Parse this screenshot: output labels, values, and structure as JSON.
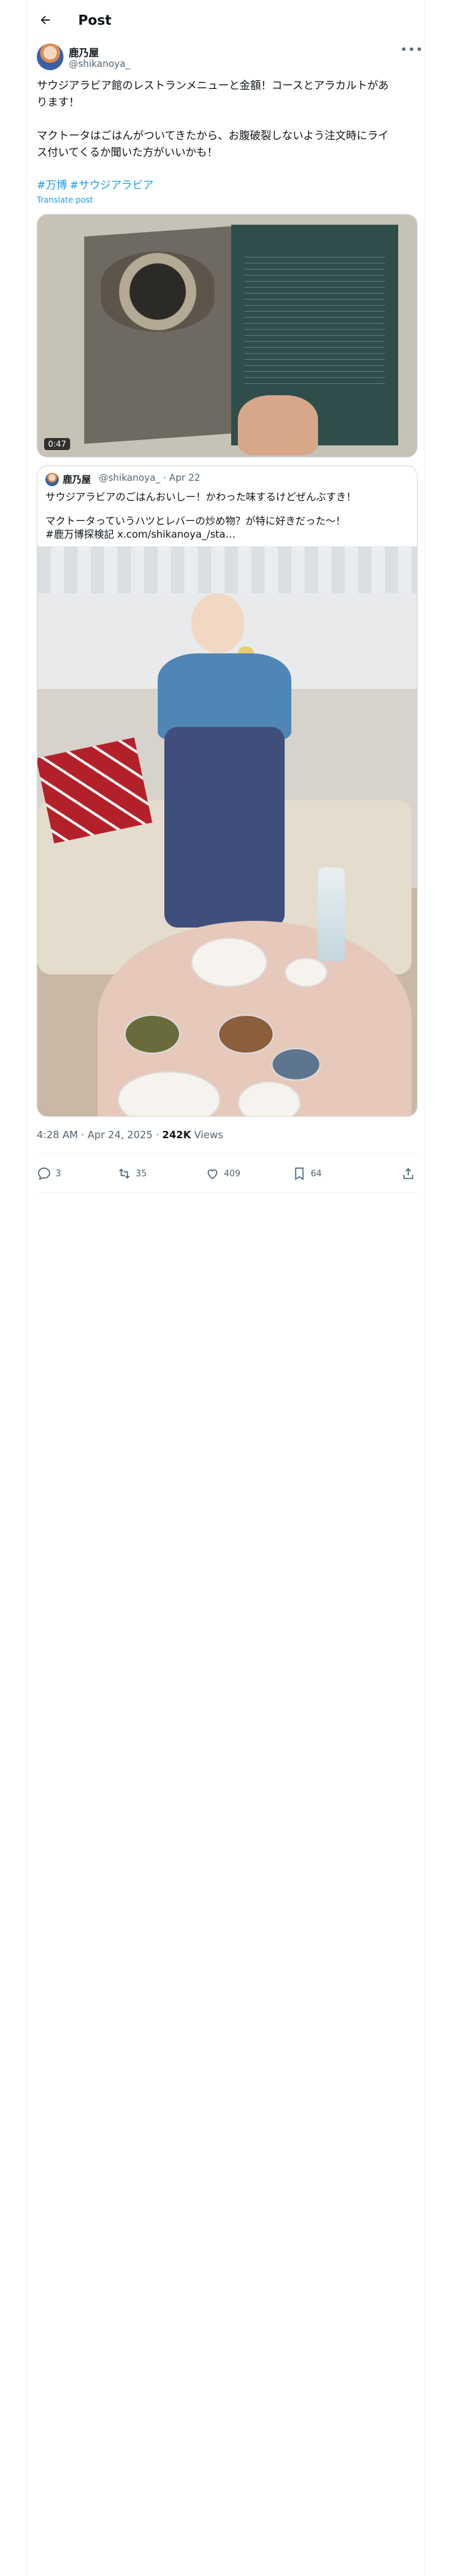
{
  "header": {
    "title": "Post"
  },
  "author": {
    "name": "鹿乃屋",
    "handle": "@shikanoya_"
  },
  "post": {
    "line1": "サウジアラビア館のレストランメニューと金額！コースとアラカルトがあ",
    "line2": "ります！",
    "line3": "マクトータはごはんがついてきたから、お腹破裂しないよう注文時にライ",
    "line4": "ス付いてくるか聞いた方がいいかも！",
    "hashtags": [
      "#万博",
      "#サウジアラビア"
    ],
    "translate": "Translate post"
  },
  "media": {
    "duration": "0:47"
  },
  "quote": {
    "name": "鹿乃屋",
    "meta": "@shikanoya_ · Apr 22",
    "line1": "サウジアラビアのごはんおいしー！かわった味するけどぜんぶすき！",
    "line2": "マクトータっていうハツとレバーの炒め物？が特に好きだった〜！",
    "line3": "#鹿万博探検記 x.com/shikanoya_/sta…"
  },
  "timestamp": {
    "time": "4:28 AM · Apr 24, 2025 · ",
    "views_count": "242K",
    "views_label": " Views"
  },
  "actions": {
    "replies": "3",
    "reposts": "35",
    "likes": "409",
    "bookmarks": "64"
  },
  "icons": [
    "back-arrow-icon",
    "more-icon",
    "reply-icon",
    "repost-icon",
    "like-icon",
    "bookmark-icon",
    "share-icon"
  ],
  "colors": {
    "link": "#1d9bf0",
    "muted": "#536471",
    "text": "#0f1419"
  }
}
